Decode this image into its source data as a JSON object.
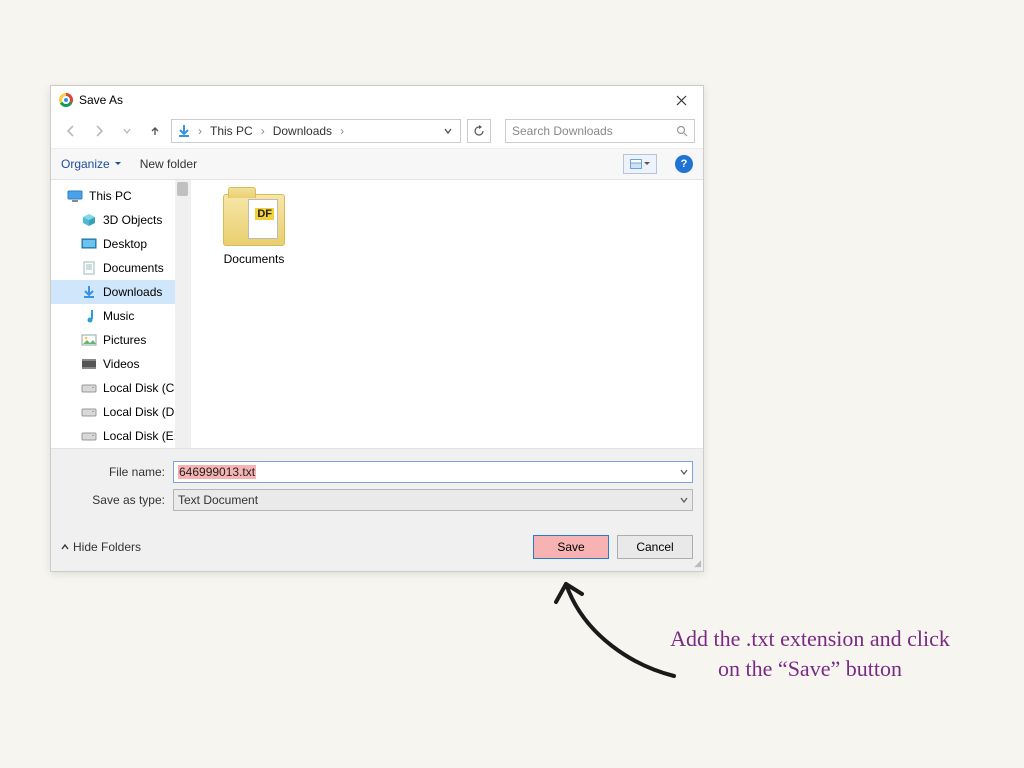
{
  "titlebar": {
    "title": "Save As"
  },
  "nav": {
    "crumbs": [
      "This PC",
      "Downloads"
    ],
    "search_placeholder": "Search Downloads"
  },
  "toolbar": {
    "organize": "Organize",
    "new_folder": "New folder"
  },
  "tree": {
    "items": [
      {
        "label": "This PC",
        "icon": "pc",
        "sub": false,
        "selected": false
      },
      {
        "label": "3D Objects",
        "icon": "3d",
        "sub": true,
        "selected": false
      },
      {
        "label": "Desktop",
        "icon": "desktop",
        "sub": true,
        "selected": false
      },
      {
        "label": "Documents",
        "icon": "docs",
        "sub": true,
        "selected": false
      },
      {
        "label": "Downloads",
        "icon": "downloads",
        "sub": true,
        "selected": true
      },
      {
        "label": "Music",
        "icon": "music",
        "sub": true,
        "selected": false
      },
      {
        "label": "Pictures",
        "icon": "pictures",
        "sub": true,
        "selected": false
      },
      {
        "label": "Videos",
        "icon": "videos",
        "sub": true,
        "selected": false
      },
      {
        "label": "Local Disk (C:)",
        "icon": "disk",
        "sub": true,
        "selected": false
      },
      {
        "label": "Local Disk (D:)",
        "icon": "disk",
        "sub": true,
        "selected": false
      },
      {
        "label": "Local Disk (E:)",
        "icon": "disk",
        "sub": true,
        "selected": false
      }
    ]
  },
  "content": {
    "items": [
      {
        "label": "Documents"
      }
    ]
  },
  "fields": {
    "filename_label": "File name:",
    "filename_value": "646999013.txt",
    "saveastype_label": "Save as type:",
    "saveastype_value": "Text Document"
  },
  "footer": {
    "hide_folders": "Hide Folders",
    "save": "Save",
    "cancel": "Cancel"
  },
  "annotation": {
    "text": "Add the .txt extension and click on the “Save” button"
  }
}
